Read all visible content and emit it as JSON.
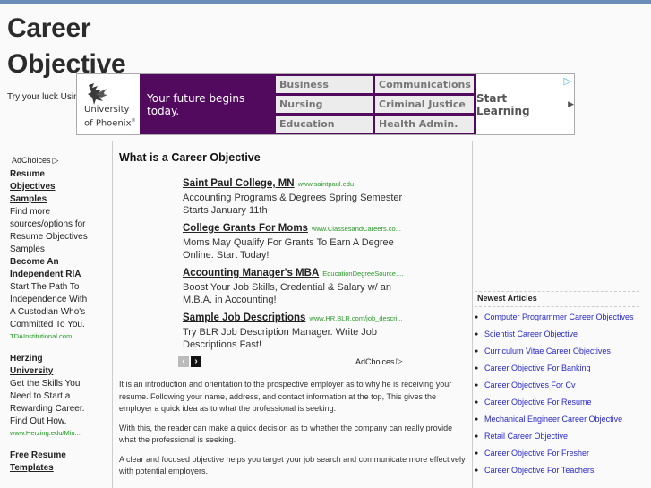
{
  "site": {
    "title_line1": "Career",
    "title_line2": "Objective",
    "tagline": "Try your luck Using"
  },
  "banner_ad": {
    "advertiser_line1": "University",
    "advertiser_line2": "of Phoenix",
    "registered_mark": "®",
    "slogan": "Your future begins today.",
    "programs": [
      "Business",
      "Communications",
      "Nursing",
      "Criminal Justice",
      "Education",
      "Health Admin."
    ],
    "cta": "Start Learning",
    "cta_arrow": "▶",
    "adchoices_icon": "▷",
    "colors": {
      "brand_purple": "#520a5e"
    }
  },
  "left_ads": {
    "adchoices_label": "AdChoices",
    "adchoices_icon": "▷",
    "items": [
      {
        "title_plain": "Resume",
        "title_link": "Objectives Samples",
        "desc": "Find more sources/options for Resume Objectives Samples",
        "url": ""
      },
      {
        "title_plain": "Become An",
        "title_link": "Independent RIA",
        "desc": "Start The Path To Independence With A Custodian Who's Committed To You.",
        "url": "TDAInstitutional.com"
      },
      {
        "title_plain": "Herzing",
        "title_link": "University",
        "desc": "Get the Skills You Need to Start a Rewarding Career. Find Out How.",
        "url": "www.Herzing.edu/Min..."
      },
      {
        "title_plain": "Free Resume",
        "title_link": "Templates",
        "desc": "",
        "url": ""
      }
    ]
  },
  "main": {
    "title": "What is a Career Objective",
    "ads": [
      {
        "title": "Saint Paul College, MN",
        "url": "www.saintpaul.edu",
        "desc": "Accounting Programs & Degrees Spring Semester Starts January 11th"
      },
      {
        "title": "College Grants For Moms",
        "url": "www.ClassesandCareers.co...",
        "desc": "Moms May Qualify For Grants To Earn A Degree Online. Start Today!"
      },
      {
        "title": "Accounting Manager's MBA",
        "url": "EducationDegreeSource....",
        "desc": "Boost Your Job Skills, Credential & Salary w/ an M.B.A. in Accounting!"
      },
      {
        "title": "Sample Job Descriptions",
        "url": "www.HR.BLR.com/job_descri...",
        "desc": "Try BLR Job Description Manager. Write Job Descriptions Fast!"
      }
    ],
    "ad_nav": {
      "prev": "‹",
      "next": "›"
    },
    "adchoices_label": "AdChoices",
    "adchoices_icon": "▷",
    "paragraphs": [
      "It is an introduction and orientation to the prospective employer as to why he is receiving your resume. Following your name, address, and contact information at the top, This gives the employer a quick idea as to what the professional is seeking.",
      "With this, the reader can make a quick decision as to whether the company can really provide what the professional is seeking.",
      "A clear and focused objective helps you target your job search and communicate more effectively with potential employers."
    ]
  },
  "sidebar": {
    "newest_title": "Newest Articles",
    "bullet": "●",
    "articles": [
      "Computer Programmer Career Objectives",
      "Scientist Career Objective",
      "Curriculum Vitae Career Objectives",
      "Career Objective For Banking",
      "Career Objectives For Cv",
      "Career Objective For Resume",
      "Mechanical Engineer Career Objective",
      "Retail Career Objective",
      "Career Objective For Fresher",
      "Career Objective For Teachers"
    ]
  }
}
